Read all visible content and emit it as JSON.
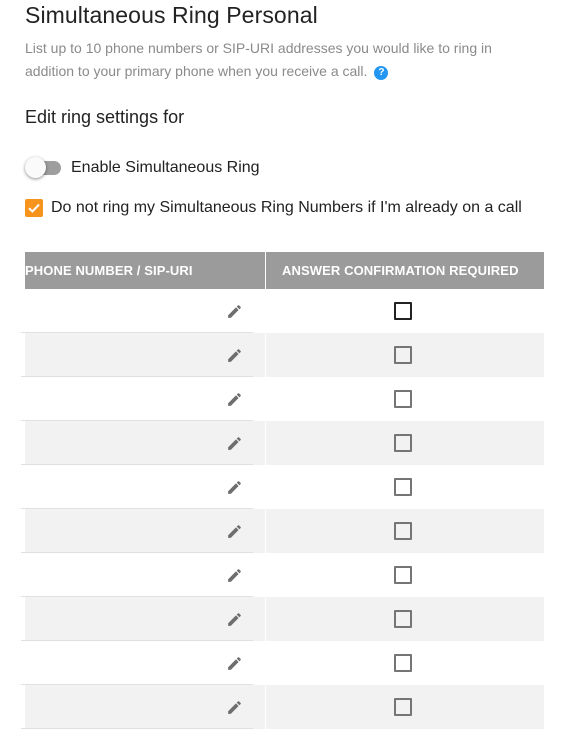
{
  "page": {
    "title": "Simultaneous Ring Personal",
    "description": "List up to 10 phone numbers or SIP-URI addresses you would like to ring in addition to your primary phone when you receive a call.",
    "help_icon_glyph": "?",
    "section_heading": "Edit ring settings for"
  },
  "settings": {
    "enable_label": "Enable Simultaneous Ring",
    "enable_on": false,
    "do_not_ring_label": "Do not ring my Simultaneous Ring Numbers if I'm already on a call",
    "do_not_ring_checked": true
  },
  "table": {
    "headers": {
      "number": "PHONE NUMBER / SIP-URI",
      "confirm": "ANSWER CONFIRMATION REQUIRED"
    },
    "rows": [
      {
        "number": "",
        "confirm": false
      },
      {
        "number": "",
        "confirm": false
      },
      {
        "number": "",
        "confirm": false
      },
      {
        "number": "",
        "confirm": false
      },
      {
        "number": "",
        "confirm": false
      },
      {
        "number": "",
        "confirm": false
      },
      {
        "number": "",
        "confirm": false
      },
      {
        "number": "",
        "confirm": false
      },
      {
        "number": "",
        "confirm": false
      },
      {
        "number": "",
        "confirm": false
      }
    ]
  },
  "colors": {
    "accent_orange": "#f7941d",
    "help_blue": "#2196f3",
    "header_gray": "#9b9b9b"
  },
  "icons": {
    "help": "help-circle-icon",
    "edit": "pencil-icon",
    "check": "check-icon"
  }
}
